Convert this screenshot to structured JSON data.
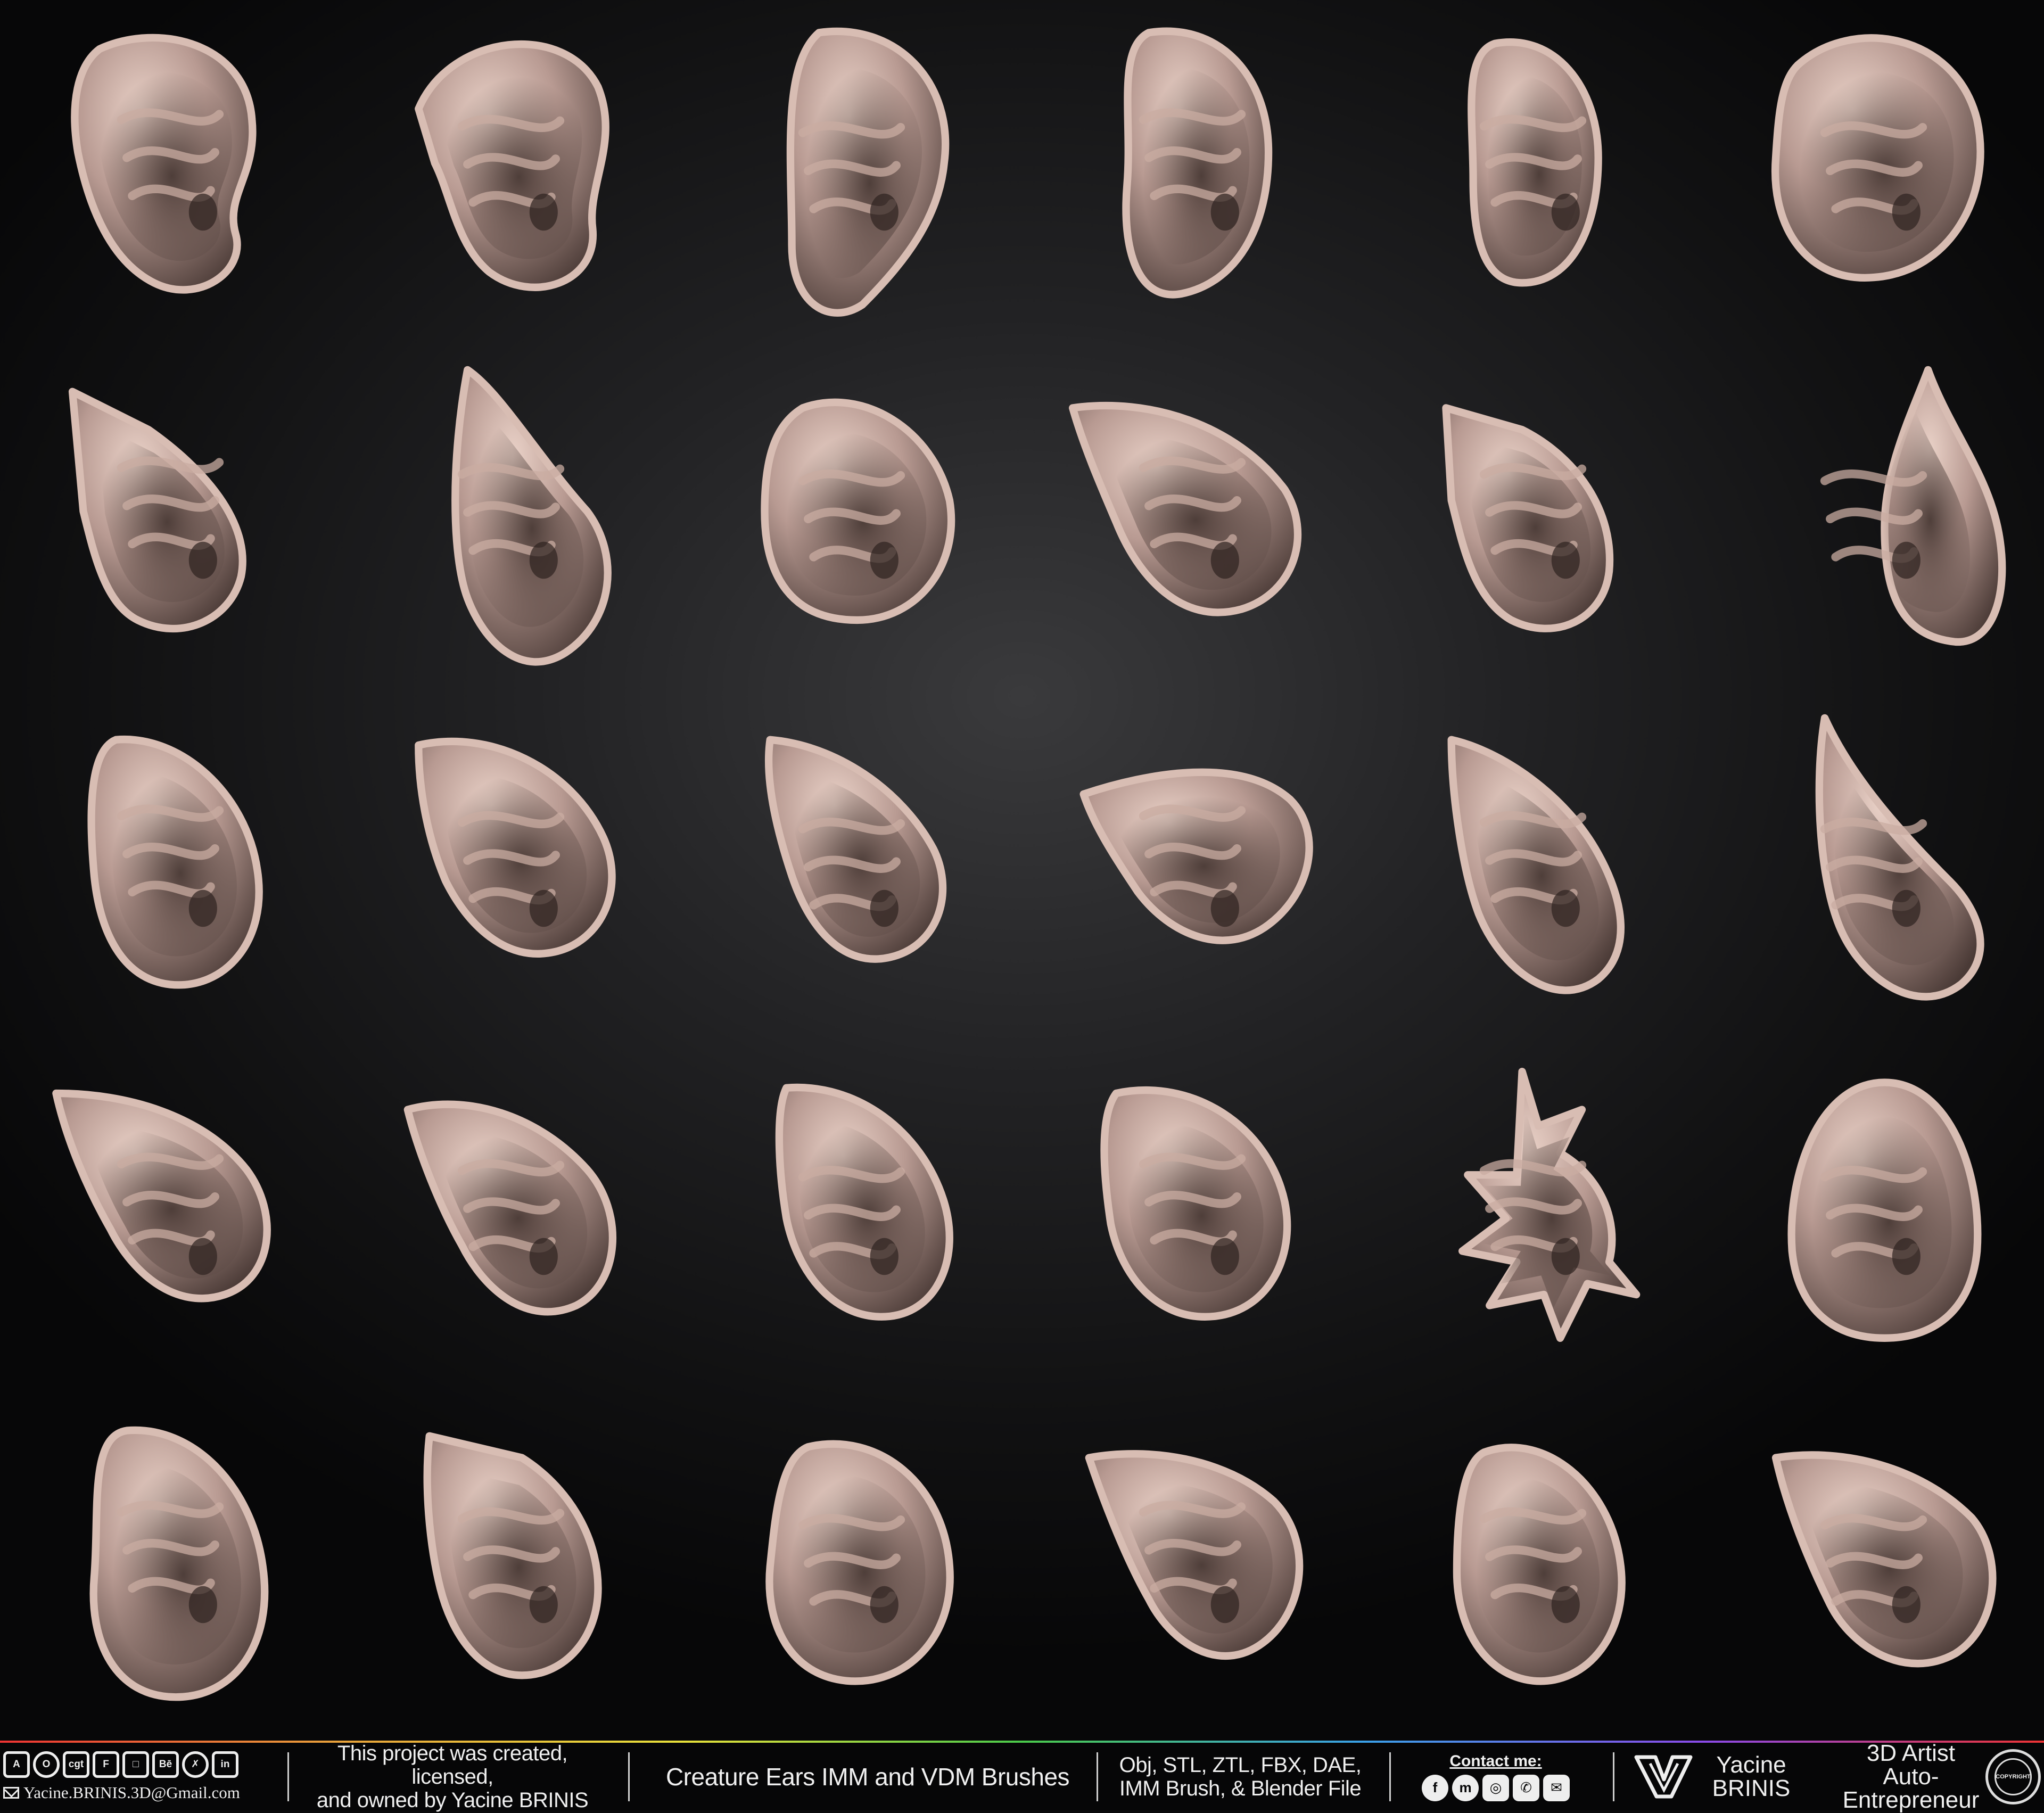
{
  "footer": {
    "social_logos": [
      "A",
      "O",
      "cgt",
      "F",
      "□",
      "Bē",
      "✗",
      "in"
    ],
    "email": "Yacine.BRINIS.3D@Gmail.com",
    "credit_line1": "This project was created, licensed,",
    "credit_line2": "and owned by Yacine BRINIS",
    "project_title": "Creature Ears IMM and VDM Brushes",
    "formats_line1": "Obj, STL, ZTL, FBX, DAE,",
    "formats_line2": "IMM Brush, & Blender File",
    "contact_label": "Contact me:",
    "contact_icons": [
      "f",
      "m",
      "◎",
      "✆",
      "✉"
    ],
    "author_first": "Yacine",
    "author_last": "BRINIS",
    "author_role1": "3D Artist",
    "author_role2": "Auto-Entrepreneur",
    "seal_text": "COPYRIGHT"
  },
  "ears": {
    "count": 30,
    "columns": 6,
    "rows": 5,
    "surface_color": "#b89a92",
    "highlight_color": "#ead2c8",
    "shadow_color": "#4a3a36"
  }
}
